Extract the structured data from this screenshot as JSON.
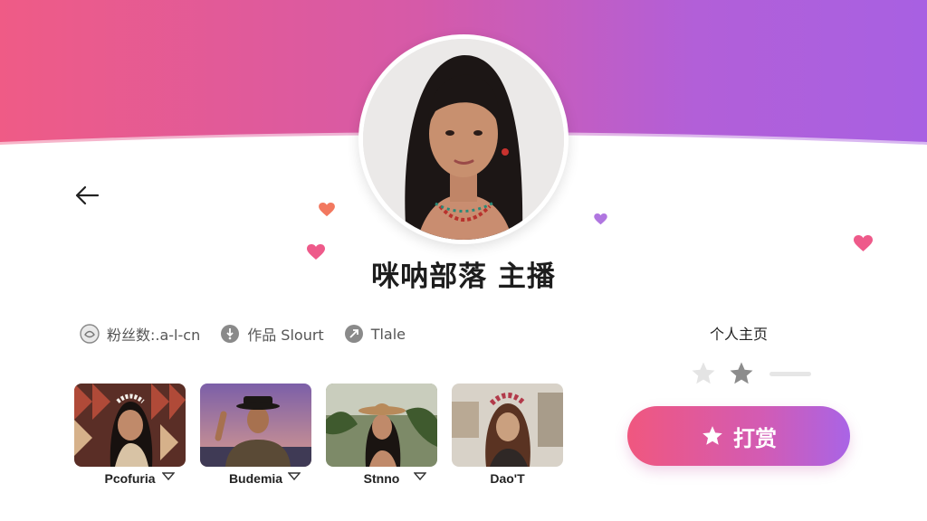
{
  "profile": {
    "title": "咪呐部落 主播",
    "avatar_icon": "portrait-photo"
  },
  "stats": [
    {
      "label": "粉丝数:.a-l-cn",
      "icon": "fans-icon"
    },
    {
      "label": "作品 Slourt",
      "icon": "works-icon"
    },
    {
      "label": "Tlale",
      "icon": "likes-icon"
    }
  ],
  "thumbnails": [
    {
      "caption": "Pcofuria"
    },
    {
      "caption": "Budemia"
    },
    {
      "caption": "Stnno"
    },
    {
      "caption": "Dao'T"
    }
  ],
  "sidebar": {
    "profile_link": "个人主页",
    "rating": {
      "filled": 1,
      "max": 2
    },
    "tip_label": "打赏"
  },
  "colors": {
    "gradient_start": "#ef5b86",
    "gradient_end": "#a860e2"
  }
}
